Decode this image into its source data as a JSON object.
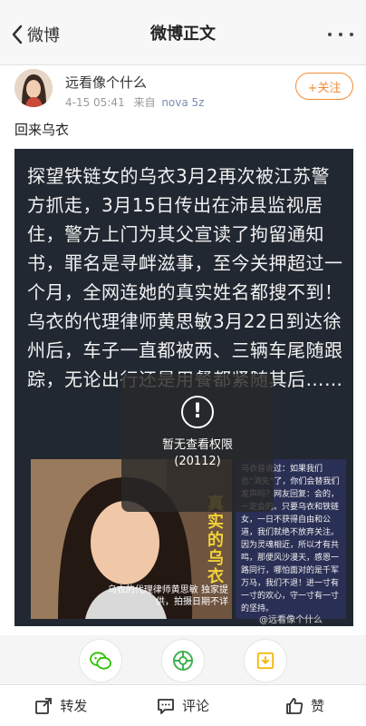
{
  "nav": {
    "back_label": "微博",
    "title": "微博正文"
  },
  "post": {
    "username": "远看像个什么",
    "time": "4-15 05:41",
    "source_prefix": "来自",
    "device": "nova 5z",
    "follow_label": "+关注",
    "text": "回来乌衣"
  },
  "image": {
    "paragraphs": [
      "探望铁链女的乌衣3月2再次被江苏警方抓走，3月15日传出在沛县监视居住，警方上门为其父宣读了拘留通知书，罪名是寻衅滋事，至今关押超过一个月，全网连她的真实姓名都搜不到！",
      "乌衣的代理律师黄思敏3月22日到达徐州后，车子一直都被两、三辆车尾随跟踪，无论出行还是用餐都紧随其后……"
    ],
    "photo_caption": "乌衣的代理律师黄思敏 独家提供，拍摄日期不详",
    "photo_stamp": "真实的乌衣",
    "side_text": "乌衣曾说过：如果我们也“消失”了，你们会替我们发声吗？网友回复：会的，一定会的。只要乌衣和铁链女，一日不获得自由和公道，我们就绝不放弃关注。因为灵魂相近，所以才有共鸣，那便风沙漫天，感恩一路同行，哪怕面对的是千军万马，我们不退！进一寸有一寸的欢心，守一寸有一寸的坚持。",
    "watermark": "@远看像个什么"
  },
  "overlay": {
    "icon": "!",
    "line1": "暂无查看权限",
    "line2": "(20112)"
  },
  "toolbar": {
    "repost": "转发",
    "comment": "评论",
    "like": "赞"
  },
  "colors": {
    "accent": "#f28c36",
    "wechat": "#2dc100",
    "moments": "#3fb24f",
    "save": "#f4b400"
  }
}
